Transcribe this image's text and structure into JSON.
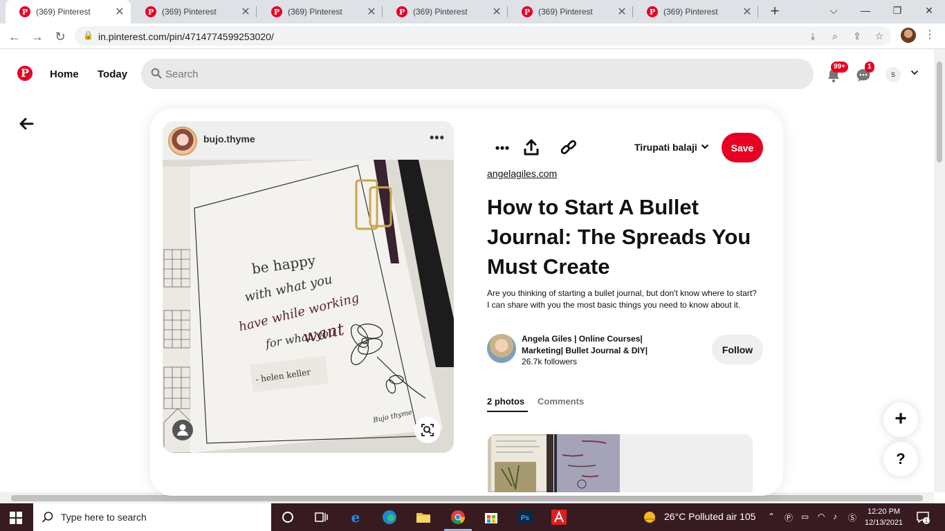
{
  "browser": {
    "tabs": [
      {
        "label": "(369) Pinterest",
        "active": true
      },
      {
        "label": "(369) Pinterest",
        "active": false
      },
      {
        "label": "(369) Pinterest",
        "active": false
      },
      {
        "label": "(369) Pinterest",
        "active": false
      },
      {
        "label": "(369) Pinterest",
        "active": false
      },
      {
        "label": "(369) Pinterest",
        "active": false
      }
    ],
    "url": "in.pinterest.com/pin/4714774599253020/"
  },
  "header": {
    "home_label": "Home",
    "today_label": "Today",
    "search_placeholder": "Search",
    "notifications_badge": "99+",
    "messages_badge": "1",
    "user_initial": "S"
  },
  "pin": {
    "creator_name": "bujo.thyme",
    "board_name": "Tirupati balaji",
    "save_label": "Save",
    "source_link": "angelagiles.com",
    "title": "How to Start A Bullet Journal: The Spreads You Must Create",
    "description": "Are you thinking of starting a bullet journal, but don't know where to start? I can share with you the most basic things you need to know about it.",
    "author_name": "Angela Giles | Online Courses| Marketing| Bullet Journal & DIY|",
    "author_followers": "26.7k followers",
    "follow_label": "Follow",
    "tabs": [
      {
        "label": "2 photos",
        "selected": true
      },
      {
        "label": "Comments",
        "selected": false
      }
    ],
    "image_text": {
      "line1": "be happy",
      "line2": "with what you",
      "line3": "have while working",
      "line4": "for what you",
      "line5": "want",
      "quote_author": "- helen keller",
      "signature": "Bujo thyme"
    }
  },
  "fab": {
    "add": "+",
    "help": "?"
  },
  "taskbar": {
    "search_placeholder": "Type here to search",
    "weather": "26°C  Polluted air 105",
    "time": "12:20 PM",
    "date": "12/13/2021",
    "notification_count": "1"
  },
  "colors": {
    "pinterest_red": "#e60023",
    "taskbar": "#371b20"
  }
}
